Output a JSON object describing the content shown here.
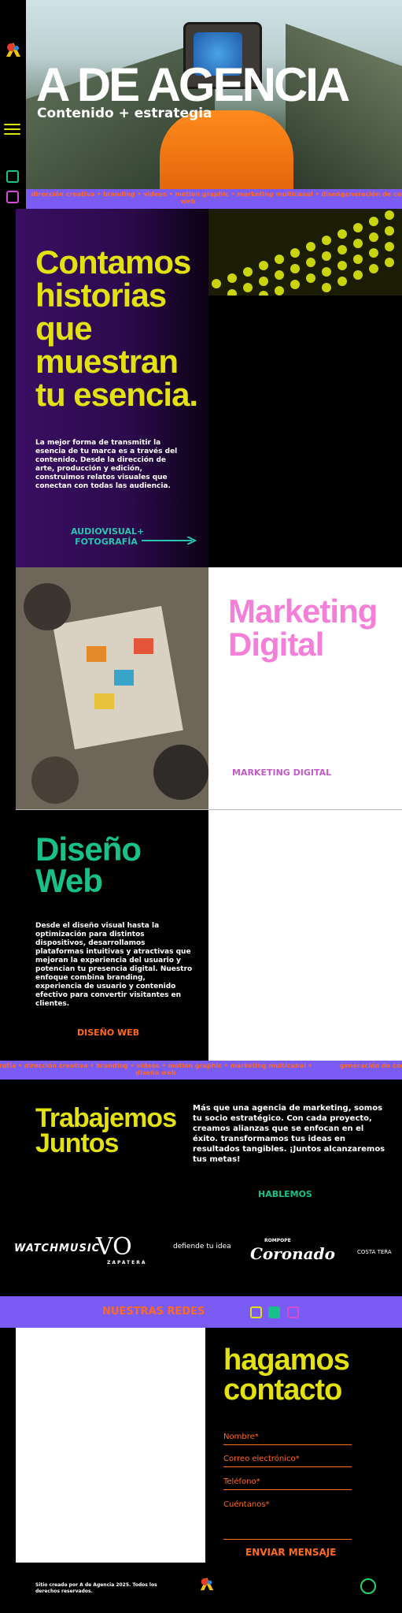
{
  "hero": {
    "title": "A DE AGENCIA",
    "subtitle": "Contenido + estrategia"
  },
  "ticker": {
    "text": "dirección creativa • branding • videos • motion graphic • marketing multicanal • diseño web",
    "text_tail": "generación de conte"
  },
  "ticker2": {
    "text": "rafía • dirección creativa • branding • videos • motion graphic • marketing multicanal • diseño web",
    "text_tail": "generación de con"
  },
  "section_story": {
    "title": "Contamos historias que muestran tu esencia.",
    "body": "La mejor forma de transmitir la esencia de tu marca es a través del contenido. Desde la dirección de arte, producción y edición, construimos relatos visuales que conectan con todas las audiencia.",
    "link": "AUDIOVISUAL+ FOTOGRAFÍA"
  },
  "section_marketing": {
    "title": "Marketing Digital",
    "link": "MARKETING DIGITAL"
  },
  "section_web": {
    "title": "Diseño Web",
    "body": "Desde el diseño visual hasta la optimización para distintos dispositivos, desarrollamos plataformas intuitivas y atractivas que mejoran la experiencia del usuario y potencian tu presencia digital. Nuestro enfoque combina branding, experiencia de usuario y contenido efectivo para convertir visitantes en clientes.",
    "link": "DISEÑO WEB"
  },
  "section_together": {
    "title": "Trabajemos Juntos",
    "body": "Más que una agencia de marketing, somos tu socio estratégico. Con cada proyecto, creamos alianzas que se enfocan en el éxito. transformamos tus ideas en resultados tangibles. ¡Juntos alcanzaremos tus metas!",
    "link": "HABLEMOS"
  },
  "brands": [
    "WATCHMUSIC",
    "VO",
    "ZAPATERA",
    "defiende tu idea",
    "ROMPOPE",
    "Coronado",
    "COSTA TERA"
  ],
  "social": {
    "label": "NUESTRAS REDES",
    "icons": [
      "linkedin-icon",
      "facebook-icon",
      "instagram-icon"
    ]
  },
  "contact": {
    "title": "hagamos contacto",
    "fields": [
      "Nombre*",
      "Correo electrónico*",
      "Teléfono*",
      "Cuéntanos*"
    ],
    "submit": "ENVIAR MENSAJE"
  },
  "footer": {
    "text": "Sitio creado por A de Agencia 2025. Todos los derechos reservados."
  },
  "colors": {
    "yellow": "#e3e10f",
    "purple": "#7a5cf5",
    "orange": "#ff6a22",
    "green": "#18c08a",
    "pink": "#f47fd8",
    "teal": "#2ac4b0"
  }
}
